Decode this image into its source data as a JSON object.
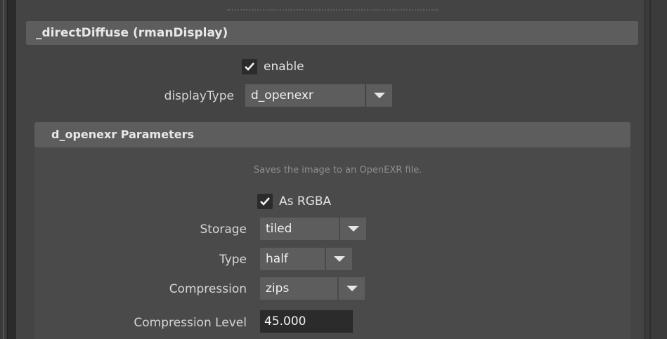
{
  "frame": {
    "title": "_directDiffuse  (rmanDisplay)",
    "enable": {
      "label": "enable",
      "checked": true
    },
    "display_type": {
      "label": "displayType",
      "value": "d_openexr"
    }
  },
  "parameters": {
    "title": "d_openexr Parameters",
    "description": "Saves the image to an OpenEXR file.",
    "as_rgba": {
      "label": "As RGBA",
      "checked": true
    },
    "storage": {
      "label": "Storage",
      "value": "tiled"
    },
    "type": {
      "label": "Type",
      "value": "half"
    },
    "compression": {
      "label": "Compression",
      "value": "zips"
    },
    "compression_level": {
      "label": "Compression Level",
      "value": "45.000"
    }
  },
  "colors": {
    "panel": "#444444",
    "header": "#5d5d5d",
    "field": "#2b2b2b",
    "text": "#d6d6d6"
  },
  "icons": {
    "checkmark": "checkmark-icon",
    "dropdown": "chevron-down-icon"
  }
}
